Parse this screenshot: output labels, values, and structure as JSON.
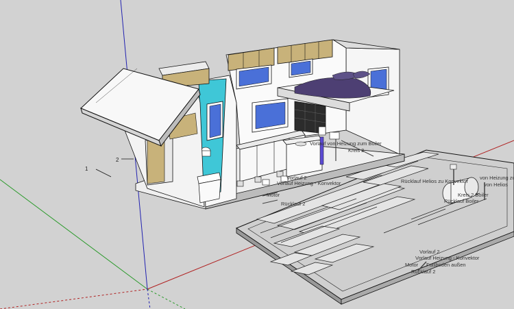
{
  "title": "SketchUp 3D model viewport",
  "dimensions": {
    "dim1": "1",
    "dim2": "2"
  },
  "annotations": {
    "vorlauf_heizung_top": "Vorlauf von Heizung zum Boiler",
    "kreis_2": "Kreis 2",
    "motor_top": "Motor",
    "vorlauf_heizung_konvektor_top": "Vorlauf Heizung - Konvektor",
    "ruecklauf_2_top": "Rücklauf 2",
    "vorlauf_2_top": "Vorlauf 2",
    "ruecklauf_helios": "Rücklauf Helios zu Konvektor",
    "von_heizung_boiler": "von Heizung zum Boiler",
    "von_helios": "von Helios",
    "kreis_2_boiler": "Kreis 2 Boiler",
    "ruecklauf_boiler": "Rücklauf Boiler",
    "vorlauf_2_bottom": "Vorlauf 2",
    "vorlauf_heizung_konvektor_bottom": "Vorlauf Heizung - Konvektor",
    "motor_bottom": "Motor",
    "fussboden_aussen": "Fußboden außen",
    "ruecklauf_2_bottom": "Rücklauf 2"
  },
  "colors": {
    "background": "#d2d2d2",
    "axis_red": "#b02020",
    "axis_green": "#2a9a2a",
    "axis_blue": "#2020b0",
    "window_blue": "#4a70d8",
    "cyan_panel": "#3fc7d7",
    "wood": "#c8b27a",
    "bed": "#4d3f73"
  }
}
